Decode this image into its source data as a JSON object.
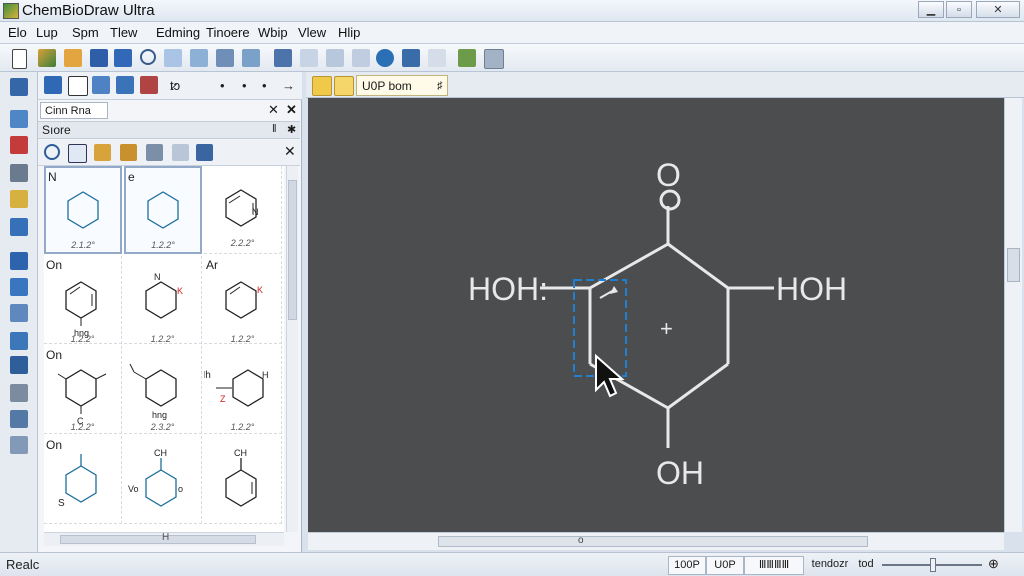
{
  "window": {
    "title": "ChemBioDraw Ultra"
  },
  "window_controls": {
    "minimize": "▁",
    "maximize": "▫",
    "close": "✕"
  },
  "menu": [
    "Elo",
    "Lup",
    "Spm",
    "Tlew",
    "Edming",
    "Tinoere",
    "Wbip",
    "Vlew",
    "Hlip"
  ],
  "tool_toolbar2": {
    "label1": "t̷ɔ",
    "arrow": "→",
    "dot1": "•",
    "dot2": "•",
    "dot3": "•",
    "plus": "+"
  },
  "panel": {
    "tab_label": "Cinn Rna",
    "close": "✕",
    "pin": "✕",
    "sub_title": "Sıore",
    "sub_grip": "‖",
    "sub_star": "✱",
    "icons_close": "✕",
    "cells": [
      {
        "label": "N",
        "caption": "2.1.2°",
        "text": ""
      },
      {
        "label": "e",
        "caption": "1.2.2°",
        "text": ""
      },
      {
        "label": "",
        "caption": "2.2.2°",
        "text": "N"
      },
      {
        "label": "On",
        "caption": "1.2.2°",
        "text": "hng"
      },
      {
        "label": "",
        "caption": "1.2.2°",
        "text": "N"
      },
      {
        "label": "Ar",
        "caption": "1.2.2°",
        "text": "K"
      },
      {
        "label": "On",
        "caption": "1.2.2°",
        "text": "C"
      },
      {
        "label": "",
        "caption": "2.3.2°",
        "text": "hng"
      },
      {
        "label": "",
        "caption": "1.2.2°",
        "text": "Hh"
      },
      {
        "label": "On",
        "caption": "",
        "text": "S"
      },
      {
        "label": "",
        "caption": "",
        "text": "CH"
      },
      {
        "label": "",
        "caption": "",
        "text": "CH"
      }
    ],
    "hscroll_label": "H"
  },
  "document": {
    "tab_label": "U0P bom",
    "tab_pin": "♯"
  },
  "molecule": {
    "top_label": "O",
    "left_label": "HOH:",
    "right_label": "HOH",
    "bottom_label": "OH",
    "center_label": "+"
  },
  "canvas": {
    "hscroll_label": "o"
  },
  "status": {
    "text": "Realc",
    "field1": "100P",
    "field2": "U0P",
    "field3": "ⅢⅢⅢⅢ",
    "field4": "tendozr",
    "field5": "tod"
  },
  "colors": {
    "canvas_bg": "#4b4d4f",
    "bond": "#e8e8e8",
    "selection": "#1f7fd0",
    "template_ring": "#1c6f9c"
  }
}
